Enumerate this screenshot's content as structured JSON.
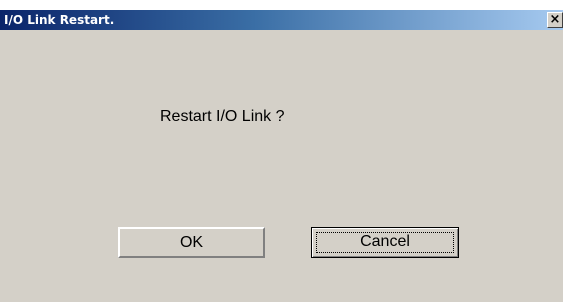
{
  "window": {
    "title": "I/O Link Restart.",
    "close_glyph": "×"
  },
  "dialog": {
    "message": "Restart I/O Link ?"
  },
  "buttons": {
    "ok_label": "OK",
    "cancel_label": "Cancel"
  },
  "colors": {
    "dialog_background": "#d4d0c8",
    "titlebar_start": "#0a246a",
    "titlebar_end": "#a6caf0"
  },
  "icons": {
    "close": "close-icon"
  }
}
